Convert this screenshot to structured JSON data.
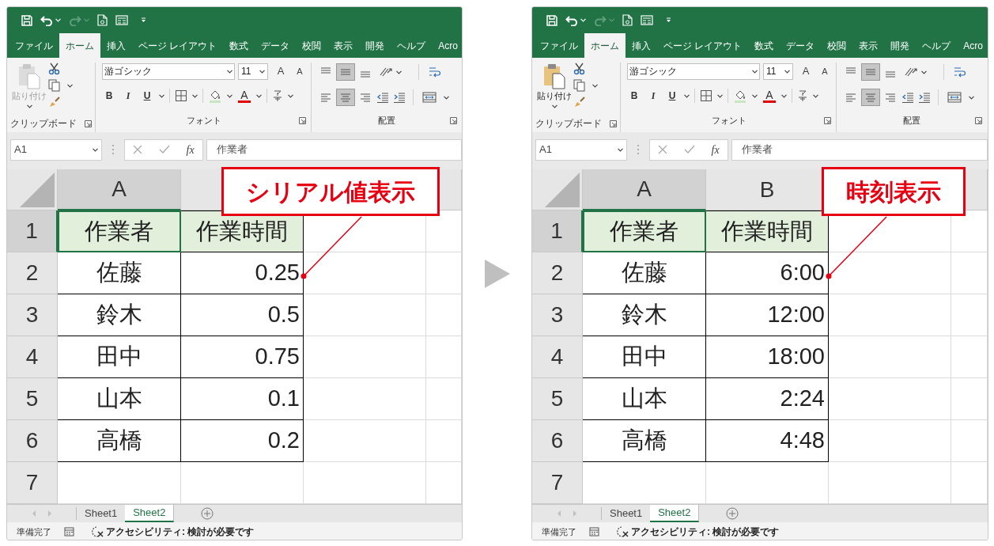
{
  "panels": [
    {
      "quick_access": {
        "redo_enabled": false
      },
      "tabs": [
        {
          "label": "ファイル",
          "selected": false
        },
        {
          "label": "ホーム",
          "selected": true
        },
        {
          "label": "挿入",
          "selected": false
        },
        {
          "label": "ページ レイアウト",
          "selected": false
        },
        {
          "label": "数式",
          "selected": false
        },
        {
          "label": "データ",
          "selected": false
        },
        {
          "label": "校閲",
          "selected": false
        },
        {
          "label": "表示",
          "selected": false
        },
        {
          "label": "開発",
          "selected": false
        },
        {
          "label": "ヘルプ",
          "selected": false
        },
        {
          "label": "Acro",
          "selected": false
        }
      ],
      "clipboard": {
        "paste_label": "貼り付け",
        "paste_enabled": false,
        "group_label": "クリップボード"
      },
      "font": {
        "name": "游ゴシック",
        "size": "11",
        "grow_label": "A",
        "shrink_label": "A",
        "styles": [
          "B",
          "I",
          "U"
        ],
        "color_label": "A",
        "group_label": "フォント"
      },
      "alignment": {
        "group_label": "配置",
        "vertical": [
          {
            "kind": "top",
            "selected": false
          },
          {
            "kind": "middle",
            "selected": true
          },
          {
            "kind": "bottom",
            "selected": false
          }
        ],
        "horizontal": [
          {
            "kind": "left",
            "selected": false
          },
          {
            "kind": "center",
            "selected": true
          },
          {
            "kind": "right",
            "selected": false
          }
        ]
      },
      "name_box": "A1",
      "fx_label": "fx",
      "formula": "作業者",
      "columns": [
        {
          "label": "A",
          "selected": true
        }
      ],
      "rows": [
        {
          "header": "1",
          "selected": true,
          "kind": "header",
          "cells": [
            "作業者",
            "作業時間"
          ]
        },
        {
          "header": "2",
          "selected": false,
          "kind": "data",
          "cells": [
            "佐藤",
            "0.25"
          ]
        },
        {
          "header": "3",
          "selected": false,
          "kind": "data",
          "cells": [
            "鈴木",
            "0.5"
          ]
        },
        {
          "header": "4",
          "selected": false,
          "kind": "data",
          "cells": [
            "田中",
            "0.75"
          ]
        },
        {
          "header": "5",
          "selected": false,
          "kind": "data",
          "cells": [
            "山本",
            "0.1"
          ]
        },
        {
          "header": "6",
          "selected": false,
          "kind": "data",
          "cells": [
            "高橋",
            "0.2"
          ]
        },
        {
          "header": "7",
          "selected": false,
          "kind": "empty"
        }
      ],
      "sheets": [
        {
          "label": "Sheet1",
          "selected": false
        },
        {
          "label": "Sheet2",
          "selected": true
        }
      ],
      "status": {
        "ready": "準備完了",
        "accessibility": "アクセシビリティ: 検討が必要です"
      },
      "callout": "シリアル値表示"
    },
    {
      "quick_access": {
        "redo_enabled": false
      },
      "tabs": [
        {
          "label": "ファイル",
          "selected": false
        },
        {
          "label": "ホーム",
          "selected": true
        },
        {
          "label": "挿入",
          "selected": false
        },
        {
          "label": "ページ レイアウト",
          "selected": false
        },
        {
          "label": "数式",
          "selected": false
        },
        {
          "label": "データ",
          "selected": false
        },
        {
          "label": "校閲",
          "selected": false
        },
        {
          "label": "表示",
          "selected": false
        },
        {
          "label": "開発",
          "selected": false
        },
        {
          "label": "ヘルプ",
          "selected": false
        },
        {
          "label": "Acro",
          "selected": false
        }
      ],
      "clipboard": {
        "paste_label": "貼り付け",
        "paste_enabled": true,
        "group_label": "クリップボード"
      },
      "font": {
        "name": "游ゴシック",
        "size": "11",
        "grow_label": "A",
        "shrink_label": "A",
        "styles": [
          "B",
          "I",
          "U"
        ],
        "color_label": "A",
        "group_label": "フォント"
      },
      "alignment": {
        "group_label": "配置",
        "vertical": [
          {
            "kind": "top",
            "selected": false
          },
          {
            "kind": "middle",
            "selected": true
          },
          {
            "kind": "bottom",
            "selected": false
          }
        ],
        "horizontal": [
          {
            "kind": "left",
            "selected": false
          },
          {
            "kind": "center",
            "selected": true
          },
          {
            "kind": "right",
            "selected": false
          }
        ]
      },
      "name_box": "A1",
      "fx_label": "fx",
      "formula": "作業者",
      "columns": [
        {
          "label": "A",
          "selected": true
        },
        {
          "label": "B",
          "selected": false
        }
      ],
      "rows": [
        {
          "header": "1",
          "selected": true,
          "kind": "header",
          "cells": [
            "作業者",
            "作業時間"
          ]
        },
        {
          "header": "2",
          "selected": false,
          "kind": "data",
          "cells": [
            "佐藤",
            "6:00"
          ]
        },
        {
          "header": "3",
          "selected": false,
          "kind": "data",
          "cells": [
            "鈴木",
            "12:00"
          ]
        },
        {
          "header": "4",
          "selected": false,
          "kind": "data",
          "cells": [
            "田中",
            "18:00"
          ]
        },
        {
          "header": "5",
          "selected": false,
          "kind": "data",
          "cells": [
            "山本",
            "2:24"
          ]
        },
        {
          "header": "6",
          "selected": false,
          "kind": "data",
          "cells": [
            "高橋",
            "4:48"
          ]
        },
        {
          "header": "7",
          "selected": false,
          "kind": "empty"
        }
      ],
      "sheets": [
        {
          "label": "Sheet1",
          "selected": false
        },
        {
          "label": "Sheet2",
          "selected": true
        }
      ],
      "status": {
        "ready": "準備完了",
        "accessibility": "アクセシビリティ: 検討が必要です"
      },
      "callout": "時刻表示"
    }
  ]
}
